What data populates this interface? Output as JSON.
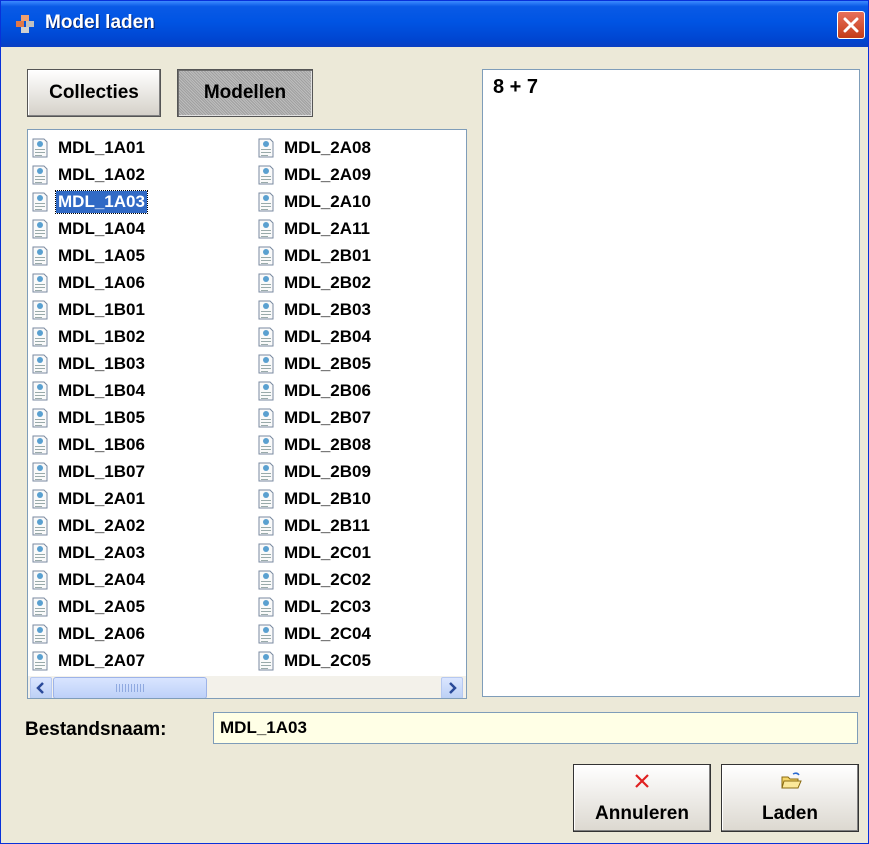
{
  "window": {
    "title": "Model laden"
  },
  "toolbar": {
    "collecties_label": "Collecties",
    "modellen_label": "Modellen"
  },
  "list": {
    "selected": "MDL_1A03",
    "column1": [
      "MDL_1A01",
      "MDL_1A02",
      "MDL_1A03",
      "MDL_1A04",
      "MDL_1A05",
      "MDL_1A06",
      "MDL_1B01",
      "MDL_1B02",
      "MDL_1B03",
      "MDL_1B04",
      "MDL_1B05",
      "MDL_1B06",
      "MDL_1B07",
      "MDL_2A01",
      "MDL_2A02",
      "MDL_2A03",
      "MDL_2A04",
      "MDL_2A05",
      "MDL_2A06",
      "MDL_2A07"
    ],
    "column2": [
      "MDL_2A08",
      "MDL_2A09",
      "MDL_2A10",
      "MDL_2A11",
      "MDL_2B01",
      "MDL_2B02",
      "MDL_2B03",
      "MDL_2B04",
      "MDL_2B05",
      "MDL_2B06",
      "MDL_2B07",
      "MDL_2B08",
      "MDL_2B09",
      "MDL_2B10",
      "MDL_2B11",
      "MDL_2C01",
      "MDL_2C02",
      "MDL_2C03",
      "MDL_2C04",
      "MDL_2C05"
    ],
    "item_icon": "model-file-icon"
  },
  "preview": {
    "text": "8 + 7"
  },
  "filename": {
    "label": "Bestandsnaam:",
    "value": "MDL_1A03"
  },
  "actions": {
    "cancel_label": "Annuleren",
    "cancel_icon": "red-x-icon",
    "load_label": "Laden",
    "load_icon": "open-folder-icon"
  },
  "colors": {
    "titlebar": "#0054e3",
    "selection": "#316ac5",
    "field_bg": "#ffffe6",
    "window_bg": "#ece9d8"
  }
}
